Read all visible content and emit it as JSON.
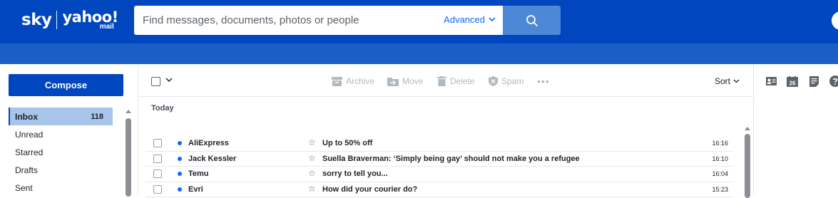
{
  "header": {
    "logo_sky": "sky",
    "logo_yahoo": "yahoo!",
    "logo_mail": "mail",
    "search_placeholder": "Find messages, documents, photos or people",
    "advanced_label": "Advanced",
    "search_icon": "search-icon"
  },
  "sidebar": {
    "compose_label": "Compose",
    "items": [
      {
        "label": "Inbox",
        "count": "118"
      },
      {
        "label": "Unread"
      },
      {
        "label": "Starred"
      },
      {
        "label": "Drafts"
      },
      {
        "label": "Sent"
      }
    ]
  },
  "toolbar": {
    "archive_label": "Archive",
    "move_label": "Move",
    "delete_label": "Delete",
    "spam_label": "Spam",
    "more_label": "•••",
    "sort_label": "Sort"
  },
  "list": {
    "group_label": "Today",
    "messages": [
      {
        "sender": "AliExpress",
        "subject": "Up to 50% off",
        "time": "16:16"
      },
      {
        "sender": "Jack Kessler",
        "subject": "Suella Braverman: ‘Simply being gay’ should not make you a refugee",
        "time": "16:10"
      },
      {
        "sender": "Temu",
        "subject": "sorry to tell you...",
        "time": "16:04"
      },
      {
        "sender": "Evri",
        "subject": "How did your courier do?",
        "time": "15:23"
      }
    ]
  },
  "rail": {
    "icons": [
      "contacts-icon",
      "calendar-icon",
      "notepad-icon",
      "help-icon"
    ],
    "calendar_day": "26"
  },
  "colors": {
    "brand": "#0046be",
    "subbar": "#1a5fc8",
    "search_button": "#4d88d6",
    "active_nav": "#a9c4ea",
    "unread_dot": "#0f69ff"
  }
}
